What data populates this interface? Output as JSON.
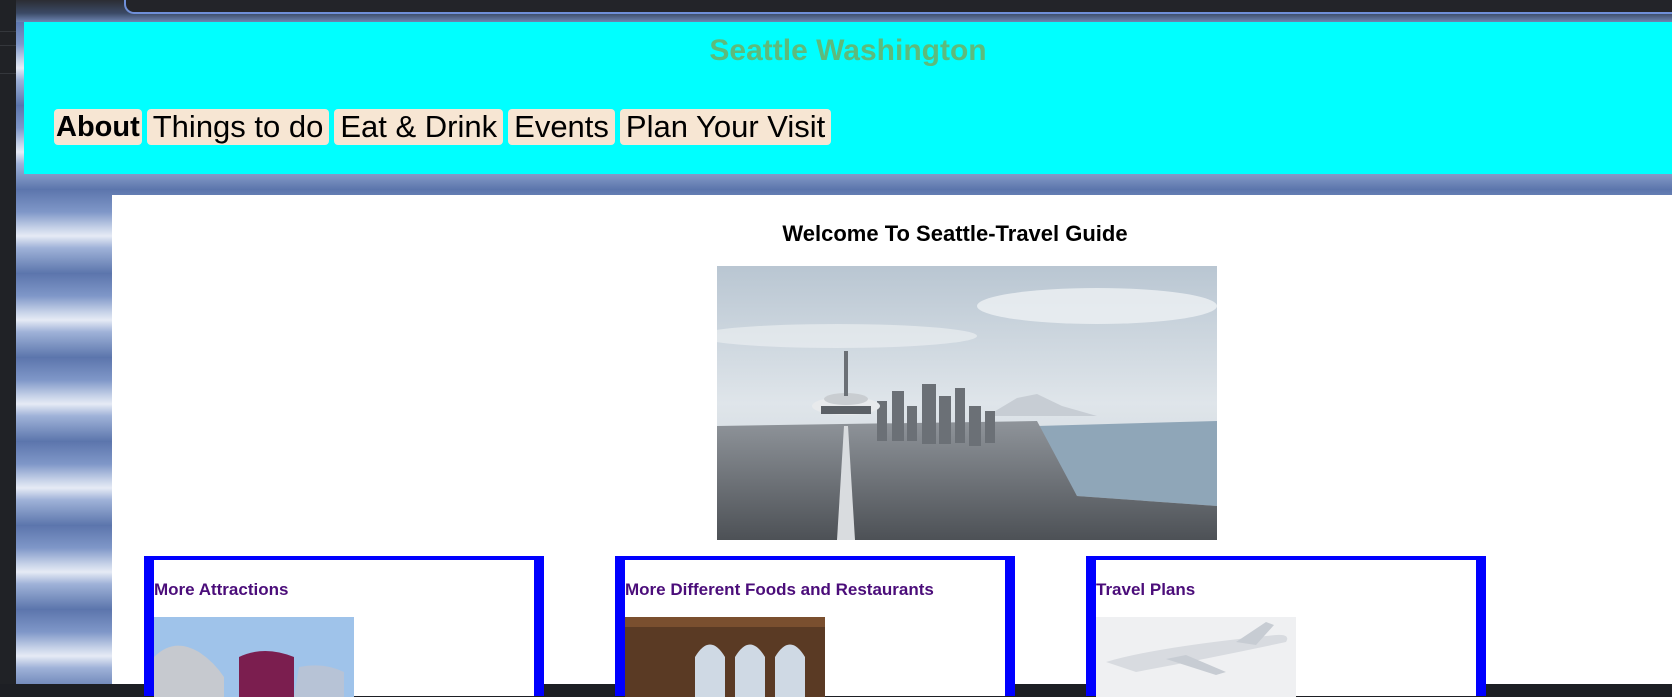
{
  "header": {
    "title": "Seattle Washington",
    "nav": [
      "About",
      "Things to do",
      "Eat & Drink",
      "Events",
      "Plan Your Visit"
    ]
  },
  "main": {
    "welcome": "Welcome To Seattle-Travel Guide",
    "cards": [
      {
        "title": "More Attractions"
      },
      {
        "title": "More Different Foods and Restaurants"
      },
      {
        "title": "Travel Plans"
      }
    ]
  },
  "colors": {
    "header_bg": "#00ffff",
    "title": "#5dbb7c",
    "nav_bg": "#f7e6d3",
    "card_border": "#0000ff",
    "card_title": "#4b0d7a"
  }
}
